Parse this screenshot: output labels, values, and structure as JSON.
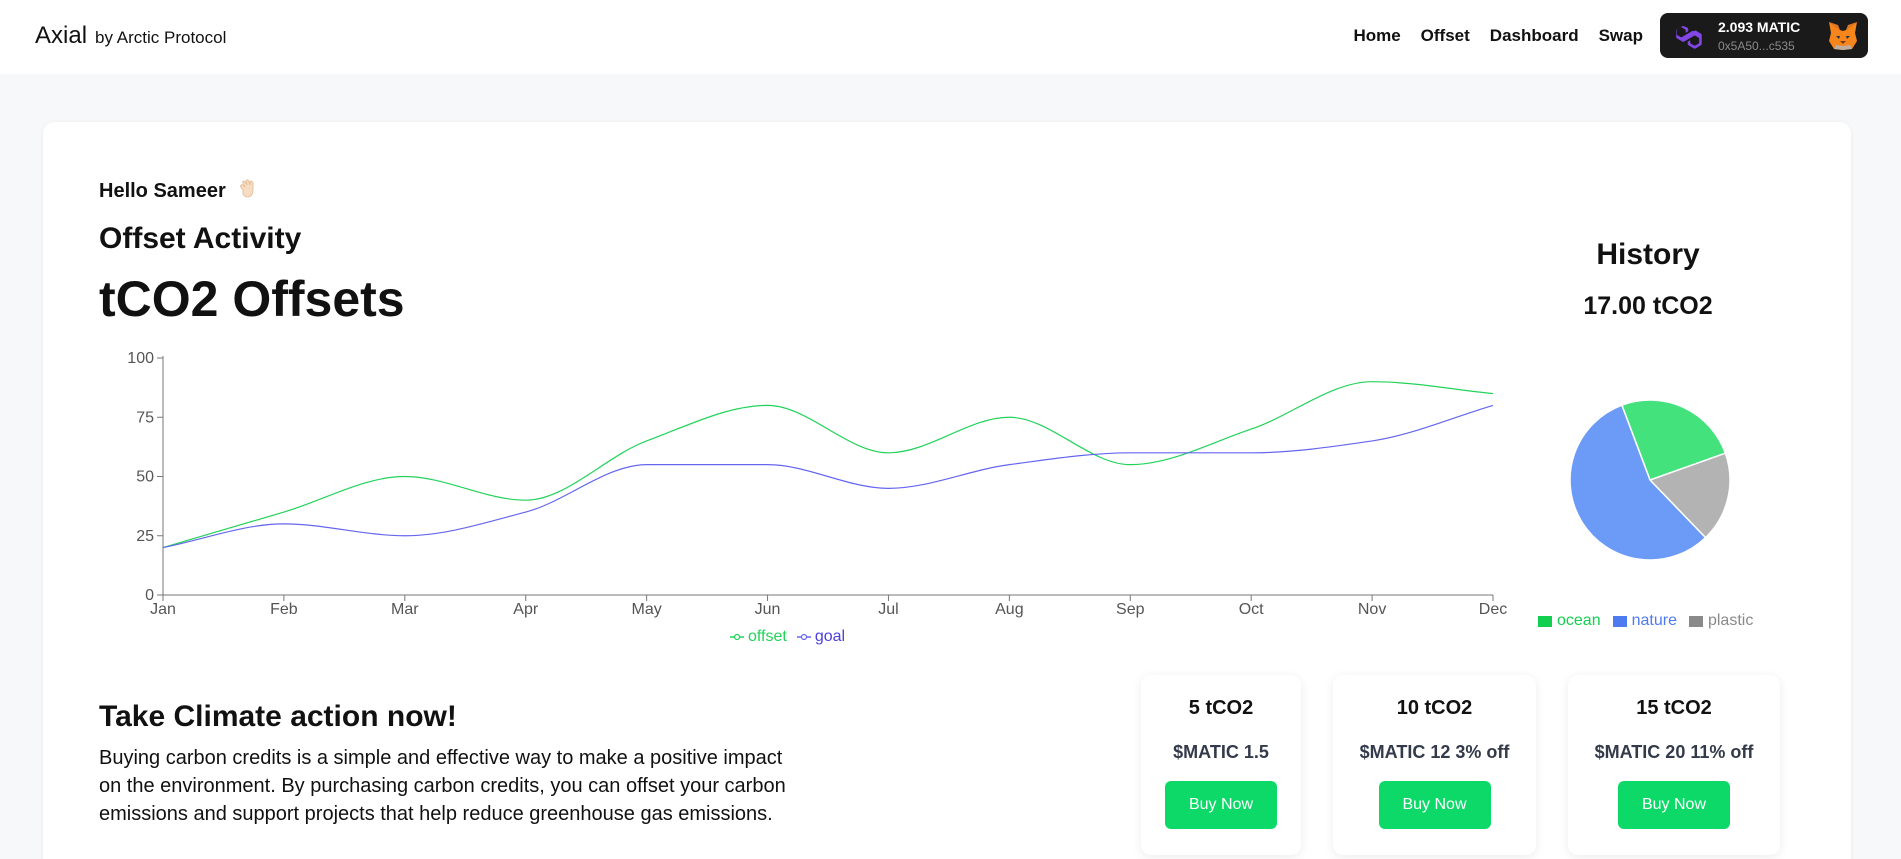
{
  "header": {
    "brand": "Axial",
    "brand_sub": "by Arctic Protocol",
    "nav": [
      "Home",
      "Offset",
      "Dashboard",
      "Swap"
    ],
    "wallet": {
      "balance": "2.093 MATIC",
      "address": "0x5A50...c535",
      "icon": "polygon-icon",
      "avatar_icon": "metamask-fox-icon"
    }
  },
  "main": {
    "greeting": "Hello Sameer",
    "greeting_icon": "waving-hand-icon",
    "section_title": "Offset Activity",
    "big_title": "tCO2 Offsets"
  },
  "chart_data": [
    {
      "type": "line",
      "categories": [
        "Jan",
        "Feb",
        "Mar",
        "Apr",
        "May",
        "Jun",
        "Jul",
        "Aug",
        "Sep",
        "Oct",
        "Nov",
        "Dec"
      ],
      "yticks": [
        0,
        25,
        50,
        75,
        100
      ],
      "ylim": [
        0,
        100
      ],
      "series": [
        {
          "name": "offset",
          "color": "#22d35a",
          "values": [
            20,
            35,
            50,
            40,
            65,
            80,
            60,
            75,
            55,
            70,
            90,
            85
          ]
        },
        {
          "name": "goal",
          "color": "#6666f0",
          "values": [
            20,
            30,
            25,
            35,
            55,
            55,
            45,
            55,
            60,
            60,
            65,
            80
          ]
        }
      ],
      "legend": "bottom"
    },
    {
      "type": "pie",
      "title": "History",
      "total_label": "17.00 tCO2",
      "slices": [
        {
          "name": "ocean",
          "value": 4.3,
          "color": "#44e27c",
          "label_color": "#12cf4f"
        },
        {
          "name": "plastic",
          "value": 3.1,
          "color": "#b3b3b3",
          "label_color": "#8a8a8a"
        },
        {
          "name": "nature",
          "value": 9.6,
          "color": "#6c9bf7",
          "label_color": "#4f7bf0"
        }
      ],
      "legend": "bottom"
    }
  ],
  "cta": {
    "title": "Take Climate action now!",
    "body": "Buying carbon credits is a simple and effective way to make a positive impact on the environment. By purchasing carbon credits, you can offset your carbon emissions and support projects that help reduce greenhouse gas emissions."
  },
  "offers": [
    {
      "amount": "5 tCO2",
      "price": "$MATIC 1.5",
      "button": "Buy Now"
    },
    {
      "amount": "10 tCO2",
      "price": "$MATIC 12 3% off",
      "button": "Buy Now"
    },
    {
      "amount": "15 tCO2",
      "price": "$MATIC 20 11% off",
      "button": "Buy Now"
    }
  ],
  "colors": {
    "accent": "#0cd967",
    "wallet_bg": "#1a1a1a"
  }
}
